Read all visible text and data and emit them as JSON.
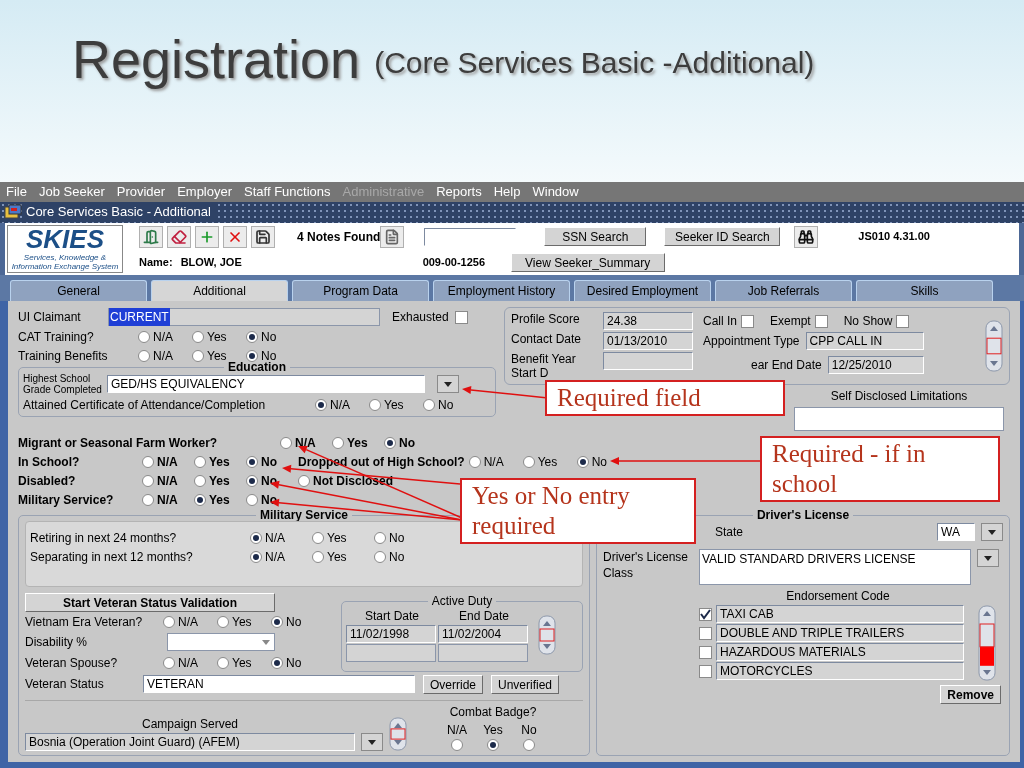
{
  "slide": {
    "title": "Registration",
    "subtitle": "(Core Services Basic -Additional)"
  },
  "menu": [
    {
      "label": "File",
      "disabled": false
    },
    {
      "label": "Job Seeker",
      "disabled": false
    },
    {
      "label": "Provider",
      "disabled": false
    },
    {
      "label": "Employer",
      "disabled": false
    },
    {
      "label": "Staff Functions",
      "disabled": false
    },
    {
      "label": "Administrative",
      "disabled": true
    },
    {
      "label": "Reports",
      "disabled": false
    },
    {
      "label": "Help",
      "disabled": false
    },
    {
      "label": "Window",
      "disabled": false
    }
  ],
  "window": {
    "title": "Core Services Basic - Additional"
  },
  "header": {
    "logo": "SKIES",
    "tagline": "Services, Knowledge & Information Exchange System",
    "notes": "4 Notes Found",
    "search_buttons": [
      "SSN Search",
      "Seeker ID Search"
    ],
    "version": "JS010 4.31.00",
    "name_label": "Name:",
    "name": "BLOW, JOE",
    "ssn": "009-00-1256",
    "summary_button": "View Seeker_Summary"
  },
  "tabs": [
    {
      "label": "General",
      "selected": false
    },
    {
      "label": "Additional",
      "selected": true
    },
    {
      "label": "Program Data",
      "selected": false
    },
    {
      "label": "Employment History",
      "selected": false
    },
    {
      "label": "Desired Employment",
      "selected": false
    },
    {
      "label": "Job Referrals",
      "selected": false
    },
    {
      "label": "Skills",
      "selected": false
    }
  ],
  "claimant": {
    "label": "UI Claimant",
    "value": "CURRENT",
    "exhausted": {
      "label": "Exhausted",
      "checked": false
    }
  },
  "top_questions": [
    {
      "label": "CAT Training?",
      "options": [
        {
          "label": "N/A",
          "selected": false
        },
        {
          "label": "Yes",
          "selected": false
        },
        {
          "label": "No",
          "selected": true
        }
      ]
    },
    {
      "label": "Training Benefits",
      "options": [
        {
          "label": "N/A",
          "selected": false
        },
        {
          "label": "Yes",
          "selected": false
        },
        {
          "label": "No",
          "selected": true
        }
      ]
    }
  ],
  "education": {
    "title": "Education",
    "grade_label": "Highest School Grade Completed",
    "grade": "GED/HS EQUIVALENCY",
    "certificate": {
      "label": "Attained Certificate of Attendance/Completion",
      "options": [
        {
          "label": "N/A",
          "selected": true
        },
        {
          "label": "Yes",
          "selected": false
        },
        {
          "label": "No",
          "selected": false
        }
      ]
    }
  },
  "questions": [
    {
      "label": "Migrant or Seasonal Farm Worker?",
      "options": [
        {
          "label": "N/A",
          "selected": false
        },
        {
          "label": "Yes",
          "selected": false
        },
        {
          "label": "No",
          "selected": true
        }
      ]
    },
    {
      "label": "In School?",
      "options": [
        {
          "label": "N/A",
          "selected": false
        },
        {
          "label": "Yes",
          "selected": false
        },
        {
          "label": "No",
          "selected": true
        }
      ],
      "follow_up": {
        "label": "Dropped out of High School?",
        "options": [
          {
            "label": "N/A",
            "selected": false
          },
          {
            "label": "Yes",
            "selected": false
          },
          {
            "label": "No",
            "selected": true
          }
        ]
      }
    },
    {
      "label": "Disabled?",
      "options": [
        {
          "label": "N/A",
          "selected": false
        },
        {
          "label": "Yes",
          "selected": false
        },
        {
          "label": "No",
          "selected": true
        },
        {
          "label": "Not Disclosed",
          "selected": false
        }
      ]
    },
    {
      "label": "Military Service?",
      "options": [
        {
          "label": "N/A",
          "selected": false
        },
        {
          "label": "Yes",
          "selected": true
        },
        {
          "label": "No",
          "selected": false
        }
      ]
    }
  ],
  "profile": {
    "fields": [
      {
        "label": "Profile Score",
        "value": "24.38"
      },
      {
        "label": "Contact Date",
        "value": "01/13/2010"
      },
      {
        "label": "Benefit Year Start D"
      }
    ],
    "flags": [
      {
        "label": "Call In",
        "checked": false
      },
      {
        "label": "Exempt",
        "checked": false
      },
      {
        "label": "No Show",
        "checked": false
      }
    ],
    "appointment_label": "Appointment Type",
    "appointment": "CPP CALL IN",
    "end_label": "ear End Date",
    "end_date": "12/25/2010"
  },
  "limitations": {
    "label": "Self Disclosed Limitations"
  },
  "military": {
    "title": "Military Service",
    "questions": [
      {
        "label": "Retiring in next 24 months?",
        "options": [
          {
            "label": "N/A",
            "selected": true
          },
          {
            "label": "Yes",
            "selected": false
          },
          {
            "label": "No",
            "selected": false
          }
        ]
      },
      {
        "label": "Separating in next 12 months?",
        "options": [
          {
            "label": "N/A",
            "selected": true
          },
          {
            "label": "Yes",
            "selected": false
          },
          {
            "label": "No",
            "selected": false
          }
        ]
      }
    ],
    "validate_button": "Start Veteran Status Validation",
    "vietnam": {
      "label": "Vietnam Era Veteran?",
      "options": [
        {
          "label": "N/A",
          "selected": false
        },
        {
          "label": "Yes",
          "selected": false
        },
        {
          "label": "No",
          "selected": true
        }
      ]
    },
    "disability_label": "Disability %",
    "spouse": {
      "label": "Veteran Spouse?",
      "options": [
        {
          "label": "N/A",
          "selected": false
        },
        {
          "label": "Yes",
          "selected": false
        },
        {
          "label": "No",
          "selected": true
        }
      ]
    },
    "status_label": "Veteran Status",
    "status": "VETERAN",
    "status_buttons": [
      "Override",
      "Unverified"
    ],
    "active_duty": {
      "title": "Active Duty",
      "columns": [
        "Start Date",
        "End Date"
      ],
      "rows": [
        [
          "11/02/1998",
          "11/02/2004"
        ]
      ]
    },
    "campaign": {
      "label": "Campaign Served",
      "value": "Bosnia (Operation Joint Guard) (AFEM)"
    },
    "combat_badge": {
      "label": "Combat Badge?",
      "options": [
        {
          "label": "N/A",
          "selected": false
        },
        {
          "label": "Yes",
          "selected": true
        },
        {
          "label": "No",
          "selected": false
        }
      ]
    }
  },
  "license": {
    "title": "Driver's License",
    "state_label": "State",
    "state": "WA",
    "class_label": "Driver's License Class",
    "class": "VALID STANDARD DRIVERS LICENSE",
    "endorsement_title": "Endorsement Code",
    "endorsements": [
      {
        "label": "TAXI CAB",
        "checked": true
      },
      {
        "label": "DOUBLE AND TRIPLE TRAILERS",
        "checked": false
      },
      {
        "label": "HAZARDOUS MATERIALS",
        "checked": false
      },
      {
        "label": "MOTORCYCLES",
        "checked": false
      }
    ],
    "remove_button": "Remove"
  },
  "callouts": [
    {
      "text": "Required field"
    },
    {
      "text": "Required - if in school"
    },
    {
      "text": "Yes or No entry required"
    }
  ]
}
